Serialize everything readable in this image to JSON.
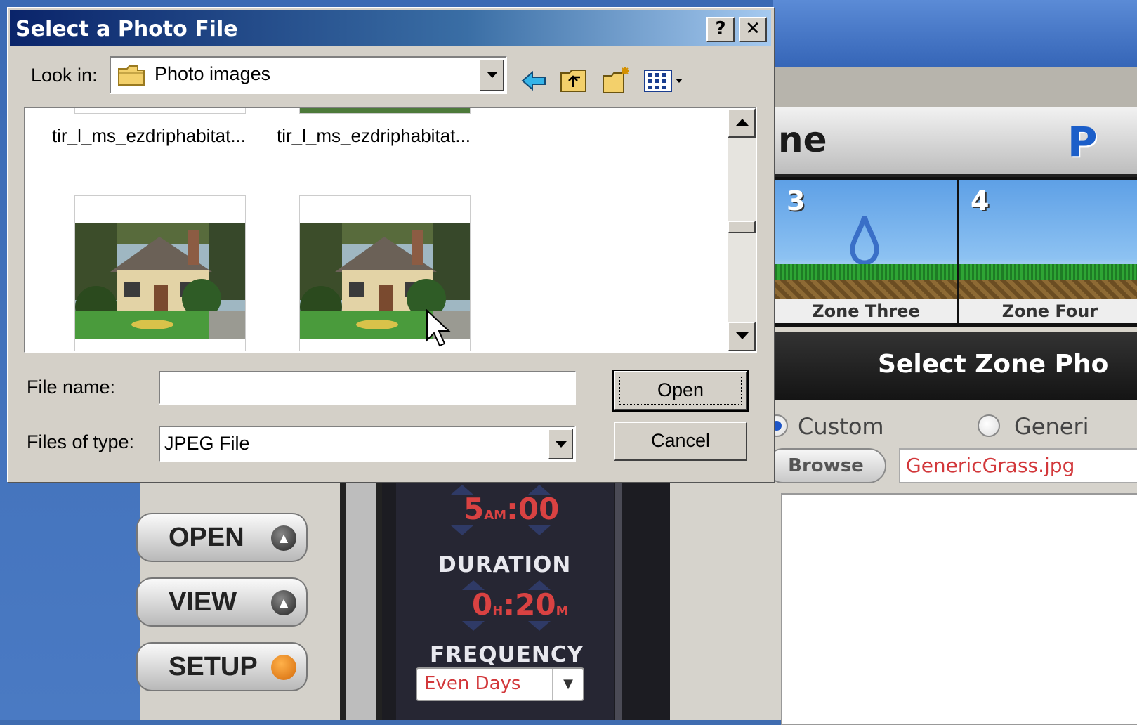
{
  "dialog": {
    "title": "Select a Photo File",
    "help_button": "?",
    "close_button": "✕",
    "look_in_label": "Look in:",
    "look_in_value": "Photo images",
    "files": [
      {
        "name": "tir_l_ms_ezdriphabitat..."
      },
      {
        "name": "tir_l_ms_ezdriphabitat..."
      }
    ],
    "file_name_label": "File name:",
    "file_name_value": "",
    "files_of_type_label": "Files of type:",
    "files_of_type_value": "JPEG File",
    "open_button": "Open",
    "cancel_button": "Cancel"
  },
  "app": {
    "header_word": "ne",
    "header_logo": "P",
    "zones": [
      {
        "number": "3",
        "label": "Zone Three"
      },
      {
        "number": "4",
        "label": "Zone Four"
      }
    ],
    "band_text": "Select Zone Pho",
    "custom_label": "Custom",
    "generic_label": "Generi",
    "browse_button": "Browse",
    "photo_file": "GenericGrass.jpg",
    "side_buttons": [
      {
        "label": "OPEN"
      },
      {
        "label": "VIEW"
      },
      {
        "label": "SETUP"
      }
    ],
    "start_hour": "5",
    "start_ampm": "AM",
    "start_minutes": ":00",
    "duration_label": "DURATION",
    "duration_hours": "0",
    "duration_h_unit": "H",
    "duration_minutes": ":20",
    "duration_m_unit": "M",
    "frequency_label": "FREQUENCY",
    "frequency_value": "Even Days"
  },
  "colors": {
    "title_bar_start": "#0a246a",
    "title_bar_end": "#a6caf0",
    "accent_red": "#d2373a",
    "dialog_face": "#d4d0c8"
  }
}
